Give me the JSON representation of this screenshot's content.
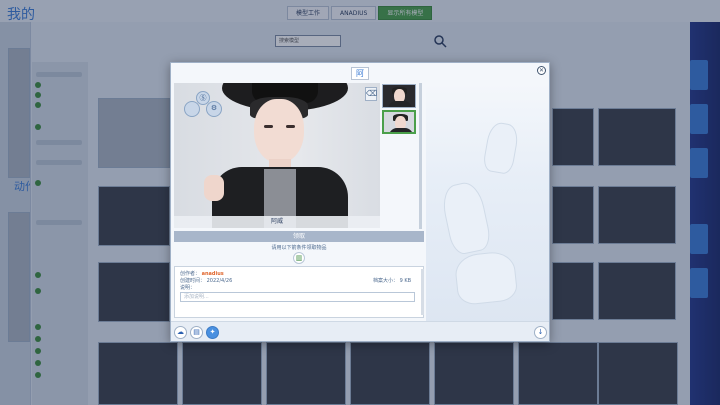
{
  "app": {
    "title": "我的",
    "tabs": [
      "模型工作",
      "ANADIUS",
      "显示所有模型"
    ],
    "search_placeholder": "搜索模型",
    "side_section": "按类型 · 作者",
    "anim_label": "动作"
  },
  "dialog": {
    "title": "阿",
    "close_glyph": "✕",
    "preview": {
      "item_name": "阿威",
      "badges": [
        "Ⓢ",
        "⚙"
      ]
    },
    "get_button_label": "领取",
    "hint_text": "请用以下箭条件领取物品",
    "info": {
      "author_label": "创作者：",
      "author": "anadius",
      "date_label": "创建时间：",
      "date": "2022/4/26",
      "size_label": "档案大小：",
      "size": "9 KB",
      "desc_label": "说明：",
      "desc_placeholder": "添加说明..."
    },
    "footer_buttons": [
      "upload",
      "delete",
      "twitter",
      "download"
    ]
  }
}
